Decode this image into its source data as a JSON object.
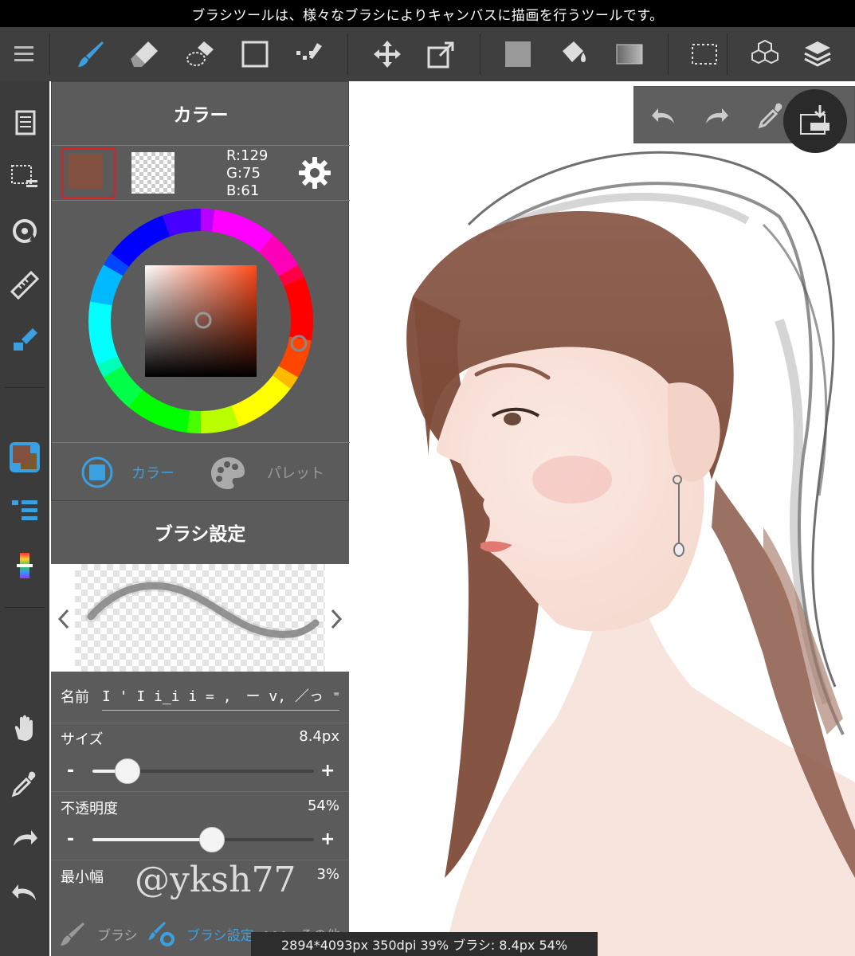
{
  "hint_text": "ブラシツールは、様々なブラシによりキャンバスに描画を行うツールです。",
  "toolbar": {
    "items": [
      "menu-icon",
      "brush-tool",
      "eraser-tool",
      "lasso-eraser-tool",
      "shape-tool",
      "select-pen-tool",
      "move-tool",
      "transform-tool",
      "fill-color",
      "bucket-tool",
      "gradient-tool",
      "selection-tool",
      "3d-material-tool",
      "layers-button"
    ],
    "active": "brush-tool",
    "accent": "#3aa0e0"
  },
  "sidebar": {
    "items": [
      "pages-icon",
      "selection-list-icon",
      "rotate-icon",
      "ruler-icon",
      "brush-fill-icon",
      "current-color-swatch",
      "brush-list-icon",
      "color-bar-icon",
      "hand-icon",
      "eyedropper-icon",
      "redo-icon",
      "undo-icon"
    ]
  },
  "quickbar": {
    "items": [
      "undo",
      "redo",
      "eyedropper",
      "save"
    ]
  },
  "color_panel": {
    "title": "カラー",
    "current_color": "#81503e",
    "secondary_color": "#7a5a2a",
    "r": "R:129",
    "g": "G:75",
    "b": "B:61",
    "tabs": [
      {
        "label": "カラー",
        "active": true
      },
      {
        "label": "パレット",
        "active": false
      }
    ]
  },
  "brush_panel": {
    "title": "ブラシ設定",
    "name_label": "名前",
    "name_value": "I ' I i_i i = ,　ー v, ／っ ⁼ ー _ i...",
    "size_label": "サイズ",
    "size_value": "8.4px",
    "size_fraction": 0.16,
    "opacity_label": "不透明度",
    "opacity_value": "54%",
    "opacity_fraction": 0.54,
    "minwidth_label": "最小幅",
    "minwidth_value": "3%",
    "minus": "-",
    "plus": "+",
    "watermark": "@yksh77",
    "tabs": [
      {
        "label": "ブラシ",
        "active": false
      },
      {
        "label": "ブラシ設定",
        "active": true
      },
      {
        "label": "その他",
        "active": false
      }
    ]
  },
  "status_bar": "2894*4093px 350dpi 39% ブラシ: 8.4px 54%"
}
